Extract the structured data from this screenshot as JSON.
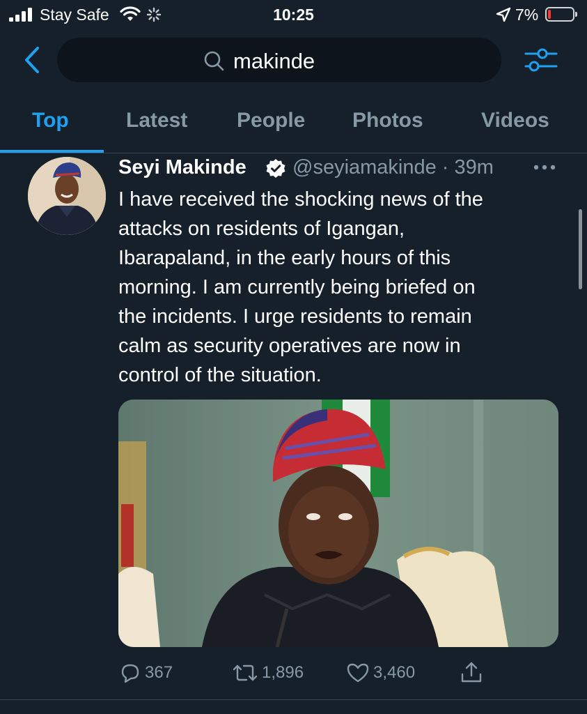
{
  "status_bar": {
    "carrier": "Stay Safe",
    "time": "10:25",
    "battery_percent": "7%",
    "battery_level": 0.07,
    "icons": [
      "signal-icon",
      "wifi-icon",
      "activity-spinner-icon",
      "location-arrow-icon",
      "battery-icon"
    ]
  },
  "search": {
    "query": "makinde"
  },
  "tabs": [
    "Top",
    "Latest",
    "People",
    "Photos",
    "Videos"
  ],
  "active_tab": "Top",
  "tweet": {
    "name": "Seyi Makinde",
    "handle_time": "@seyiamakinde · 39m",
    "text": "I have received the shocking news of the\nattacks on residents of Igangan,\nIbarapaland, in the early hours of this\nmorning. I am currently being briefed on\nthe incidents. I urge residents to remain\ncalm as security operatives are now in\ncontrol of the situation.",
    "replies": "367",
    "retweets": "1,896",
    "likes": "3,460"
  },
  "colors": {
    "background": "#15202b",
    "accent": "#1da1f2",
    "muted": "#8899a6",
    "divider": "#38444d"
  }
}
